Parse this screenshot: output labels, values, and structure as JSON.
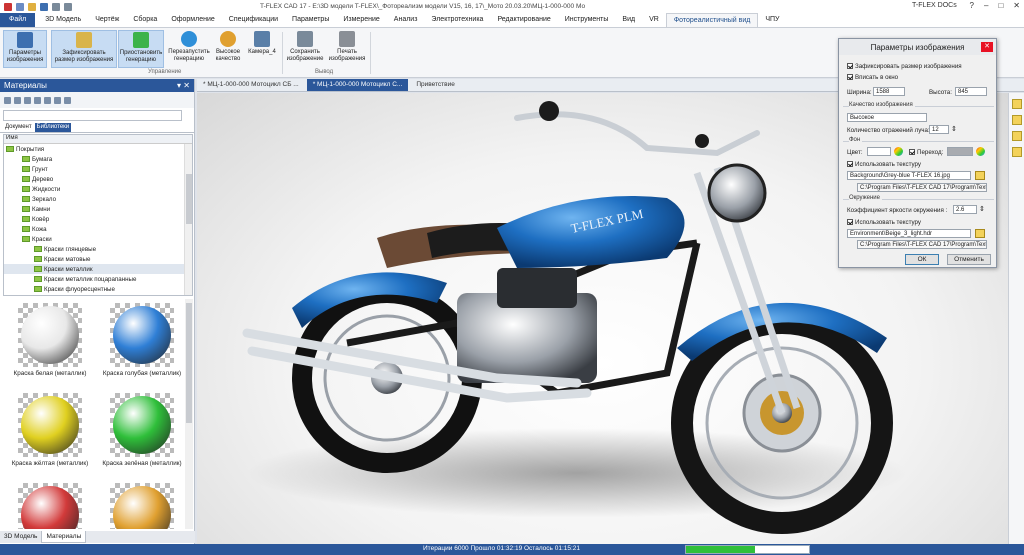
{
  "titlebar": {
    "title": "T-FLEX CAD 17 - E:\\3D модели T-FLEX\\_Фотореализм модели V15, 16, 17\\_Мото 20.03.20\\МЦ-1-000-000 Мо",
    "brand": "T-FLEX DOCs",
    "help": "?",
    "minimize": "–",
    "maximize": "□",
    "close": "✕"
  },
  "menu": {
    "tabs": [
      "Файл",
      "3D Модель",
      "Чертёж",
      "Сборка",
      "Оформление",
      "Спецификации",
      "Параметры",
      "Измерение",
      "Анализ",
      "Электротехника",
      "Редактирование",
      "Инструменты",
      "Вид",
      "VR",
      "Фотореалистичный вид",
      "ЧПУ"
    ],
    "active": "Фотореалистичный вид"
  },
  "ribbon": {
    "buttons": [
      {
        "label": "Параметры изображения",
        "icon": "image-params-icon",
        "color": "#3d6fb0"
      },
      {
        "label": "Зафиксировать размер изображения",
        "icon": "lock-size-icon",
        "color": "#d9b44a"
      },
      {
        "label": "Приостановить генерацию",
        "icon": "pause-icon",
        "color": "#3cb34a"
      },
      {
        "label": "Перезапустить генерацию",
        "icon": "restart-icon",
        "color": "#2f8fd8"
      },
      {
        "label": "Высокое качество",
        "icon": "quality-icon",
        "color": "#e0a030"
      },
      {
        "label": "Камера_4",
        "icon": "camera-icon",
        "color": "#5a7fa8"
      },
      {
        "label": "Сохранить изображение",
        "icon": "save-image-icon",
        "color": "#7a8a9a"
      },
      {
        "label": "Печать изображения",
        "icon": "print-icon",
        "color": "#8a8f96"
      }
    ],
    "groups": [
      "Управление",
      "Вывод"
    ]
  },
  "materials_panel": {
    "title": "Материалы",
    "tabs": [
      "Документ",
      "Библиотеки"
    ],
    "active_tab": "Библиотеки",
    "search": {
      "value": "",
      "placeholder": ""
    },
    "tree_header": "Имя",
    "tree": [
      "Покрытия",
      "Бумага",
      "Грунт",
      "Дерево",
      "Жидкости",
      "Зеркало",
      "Камни",
      "Ковёр",
      "Кожа",
      "Краски",
      "Краски глянцевые",
      "Краски матовые",
      "Краски металлик",
      "Краски металлик поцарапанные",
      "Краски флуоресцентные"
    ],
    "selected_tree_item": "Краски металлик",
    "gallery": [
      {
        "label": "Краска белая (металлик)",
        "color": "#e8e8e8"
      },
      {
        "label": "Краска голубая (металлик)",
        "color": "#2f7fd6"
      },
      {
        "label": "Краска жёлтая (металлик)",
        "color": "#e0d020"
      },
      {
        "label": "Краска зелёная (металлик)",
        "color": "#2fbf3a"
      },
      {
        "label": "",
        "color": "#d23a3a"
      },
      {
        "label": "",
        "color": "#e0a030"
      }
    ],
    "bottom_tabs": [
      "3D Модель",
      "Материалы"
    ],
    "active_bottom_tab": "Материалы"
  },
  "document_tabs": [
    "* МЦ-1-000-000 Мотоцикл СБ ...",
    "* МЦ-1-000-000 Мотоцикл С...",
    "Приветствие"
  ],
  "active_document_tab": "* МЦ-1-000-000 Мотоцикл С...",
  "dialog": {
    "title": "Параметры изображения",
    "fix_size": {
      "label": "Зафиксировать размер изображения",
      "checked": true
    },
    "fit_window": {
      "label": "Вписать в окно",
      "checked": true
    },
    "width_label": "Ширина:",
    "width": "1588",
    "height_label": "Высота:",
    "height": "845",
    "quality_group": "Качество изображения",
    "quality": "Высокое",
    "reflections_label": "Количество отражений луча:",
    "reflections": "12",
    "background_group": "Фон",
    "color_label": "Цвет:",
    "gradient": {
      "label": "Переход:",
      "checked": true
    },
    "use_texture_bg": {
      "label": "Использовать текстуру",
      "checked": true
    },
    "bg_texture_name": "Background\\Grey-blue T-FLEX 16.jpg",
    "bg_texture_path": "C:\\Program Files\\T-FLEX CAD 17\\Program\\Texture",
    "environment_group": "Окружение",
    "env_brightness_label": "Коэффициент яркости окружения :",
    "env_brightness": "2.6",
    "use_texture_env": {
      "label": "Использовать текстуру",
      "checked": true
    },
    "env_texture_name": "Environment\\Beige_3_light.hdr",
    "env_texture_path": "C:\\Program Files\\T-FLEX CAD 17\\Program\\Texture",
    "ok": "ОК",
    "cancel": "Отменить"
  },
  "status": {
    "text": "Итерации 6000 Прошло 01:32:19 Осталось 01:15:21",
    "progress": 0.56
  },
  "colors": {
    "accent": "#2b579a",
    "progress": "#2fbf3a",
    "bike_blue": "#1e6fc2"
  }
}
